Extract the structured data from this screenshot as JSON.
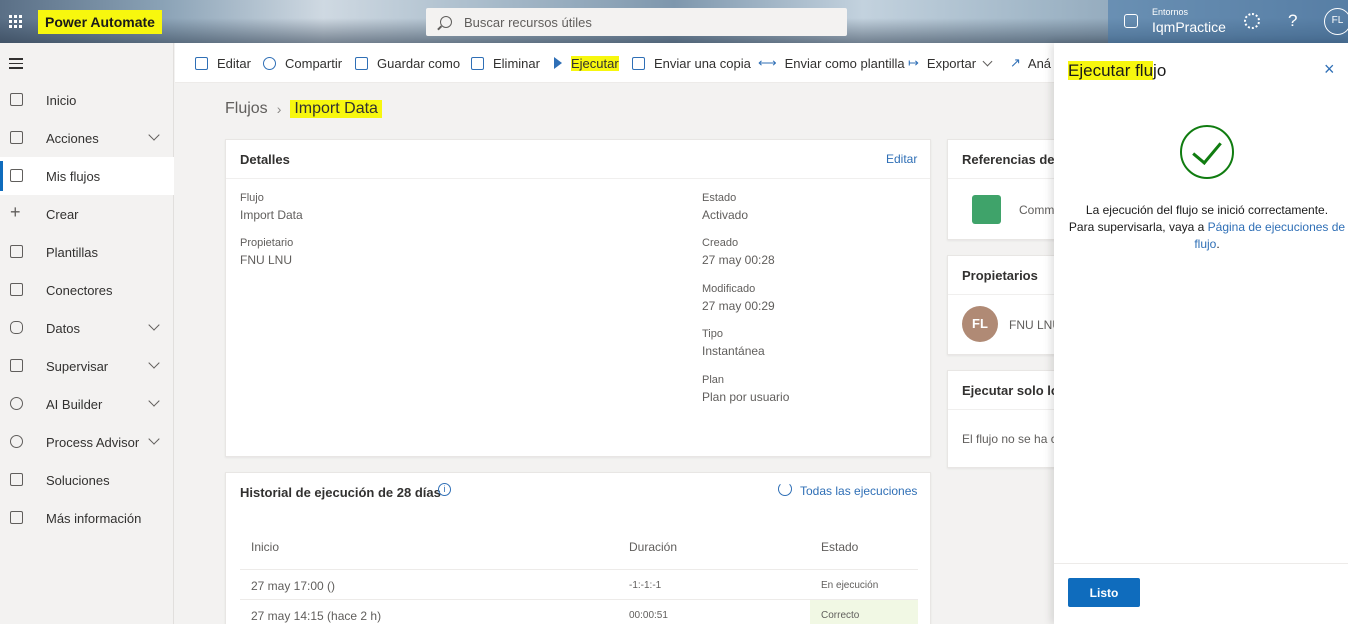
{
  "header": {
    "brand": "Power Automate",
    "search_placeholder": "Buscar recursos útiles",
    "env_label": "Entornos",
    "env_name": "IqmPractice",
    "help": "?",
    "avatar": "FL"
  },
  "sidebar": {
    "items": [
      {
        "label": "Inicio"
      },
      {
        "label": "Acciones"
      },
      {
        "label": "Mis flujos"
      },
      {
        "label": "Crear"
      },
      {
        "label": "Plantillas"
      },
      {
        "label": "Conectores"
      },
      {
        "label": "Datos"
      },
      {
        "label": "Supervisar"
      },
      {
        "label": "AI Builder"
      },
      {
        "label": "Process Advisor"
      },
      {
        "label": "Soluciones"
      },
      {
        "label": "Más información"
      }
    ]
  },
  "toolbar": {
    "edit": "Editar",
    "share": "Compartir",
    "save_as": "Guardar como",
    "delete": "Eliminar",
    "run": "Ejecutar",
    "send_copy": "Enviar una copia",
    "send_template": "Enviar como plantilla",
    "export": "Exportar",
    "analytics": "Aná"
  },
  "breadcrumb": {
    "root": "Flujos",
    "current": "Import Data"
  },
  "details": {
    "title": "Detalles",
    "edit": "Editar",
    "flow_label": "Flujo",
    "flow_value": "Import Data",
    "owner_label": "Propietario",
    "owner_value": "FNU LNU",
    "state_label": "Estado",
    "state_value": "Activado",
    "created_label": "Creado",
    "created_value": "27 may 00:28",
    "modified_label": "Modificado",
    "modified_value": "27 may 00:29",
    "type_label": "Tipo",
    "type_value": "Instantánea",
    "plan_label": "Plan",
    "plan_value": "Plan por usuario"
  },
  "history": {
    "title": "Historial de ejecución de 28 días",
    "all_runs": "Todas las ejecuciones",
    "col_start": "Inicio",
    "col_duration": "Duración",
    "col_status": "Estado",
    "rows": [
      {
        "start": "27 may 17:00 ()",
        "duration": "-1:-1:-1",
        "status": "En ejecución"
      },
      {
        "start": "27 may 14:15 (hace 2 h)",
        "duration": "00:00:51",
        "status": "Correcto"
      }
    ]
  },
  "refs": {
    "title": "Referencias de l",
    "item": "Comm"
  },
  "owners": {
    "title": "Propietarios",
    "avatar": "FL",
    "name": "FNU LNU"
  },
  "runonly": {
    "title": "Ejecutar solo los",
    "text": "El flujo no se ha c"
  },
  "panel": {
    "title_highlight": "Ejecutar flu",
    "title_rest": "jo",
    "close": "×",
    "msg_line1": "La ejecución del flujo se inició correctamente.",
    "msg_line2": "Para supervisarla, vaya a",
    "msg_link": "Página de ejecuciones de flujo",
    "msg_end": ".",
    "done": "Listo"
  }
}
